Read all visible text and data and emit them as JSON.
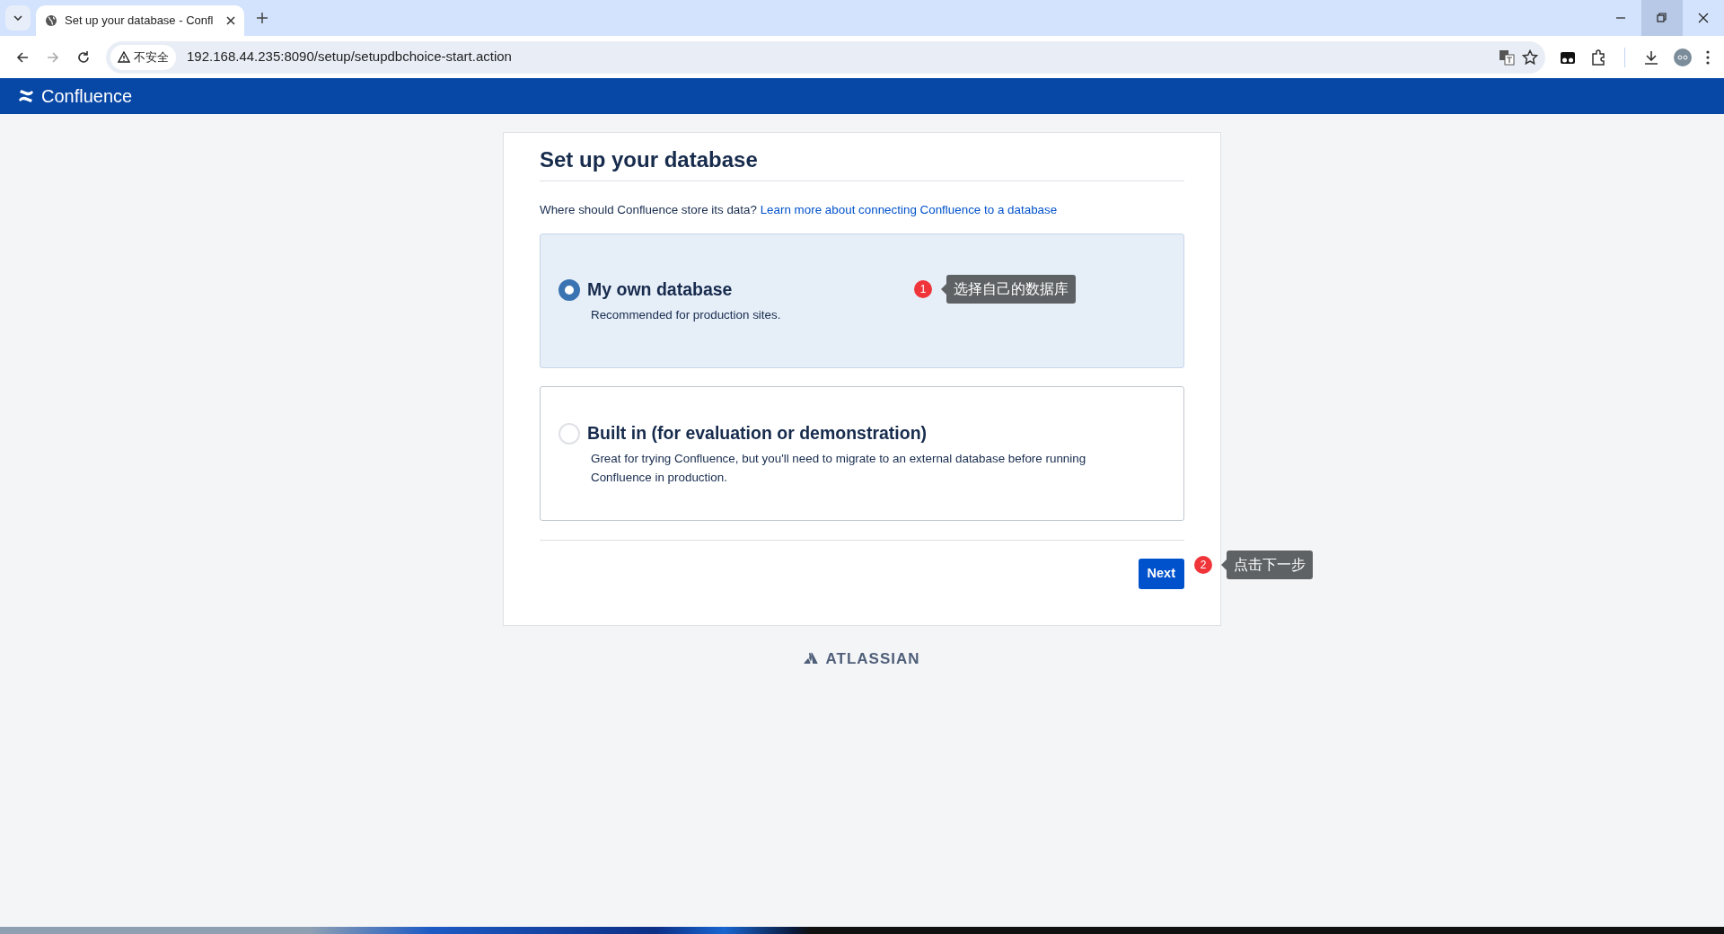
{
  "browser": {
    "tabs": [
      {
        "title": "Set up your database - Confl",
        "selected": true
      }
    ],
    "address": {
      "security": "不安全",
      "url": "192.168.44.235:8090/setup/setupdbchoice-start.action"
    }
  },
  "header": {
    "product": "Confluence"
  },
  "setup": {
    "title": "Set up your database",
    "intro": "Where should Confluence store its data?",
    "link": "Learn more about connecting Confluence to a database",
    "options": [
      {
        "label": "My own database",
        "description": "Recommended for production sites.",
        "selected": true
      },
      {
        "label": "Built in (for evaluation or demonstration)",
        "description": "Great for trying Confluence, but you'll need to migrate to an external database before running Confluence in production.",
        "selected": false
      }
    ],
    "next_button": "Next"
  },
  "footer": {
    "brand": "ATLASSIAN"
  },
  "annotations": [
    {
      "number": "1",
      "text": "选择自己的数据库"
    },
    {
      "number": "2",
      "text": "点击下一步"
    }
  ]
}
